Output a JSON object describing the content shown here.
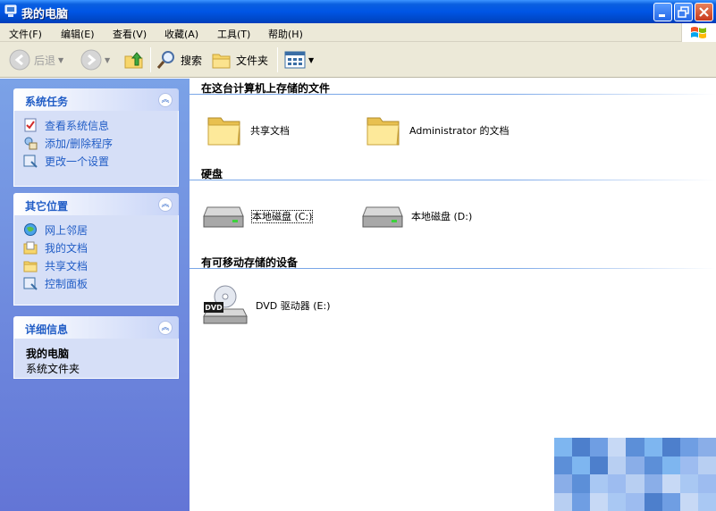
{
  "window": {
    "title": "我的电脑"
  },
  "menu": [
    "文件(F)",
    "编辑(E)",
    "查看(V)",
    "收藏(A)",
    "工具(T)",
    "帮助(H)"
  ],
  "toolbar": {
    "back": "后退",
    "search": "搜索",
    "folders": "文件夹"
  },
  "left_pane": {
    "system_tasks": {
      "title": "系统任务",
      "items": [
        "查看系统信息",
        "添加/删除程序",
        "更改一个设置"
      ]
    },
    "other_places": {
      "title": "其它位置",
      "items": [
        "网上邻居",
        "我的文档",
        "共享文档",
        "控制面板"
      ]
    },
    "details": {
      "title": "详细信息",
      "name": "我的电脑",
      "type": "系统文件夹"
    }
  },
  "content": {
    "groups": [
      {
        "title": "在这台计算机上存储的文件",
        "items": [
          "共享文档",
          "Administrator 的文档"
        ]
      },
      {
        "title": "硬盘",
        "items": [
          "本地磁盘 (C:)",
          "本地磁盘 (D:)"
        ]
      },
      {
        "title": "有可移动存储的设备",
        "items": [
          "DVD 驱动器 (E:)"
        ]
      }
    ],
    "dvd_badge": "DVD"
  },
  "colors": {
    "title_bar": "#0055e5",
    "task_pane": "#6d8ddc",
    "link": "#215dc6",
    "group_line": "#7aa7e8"
  }
}
